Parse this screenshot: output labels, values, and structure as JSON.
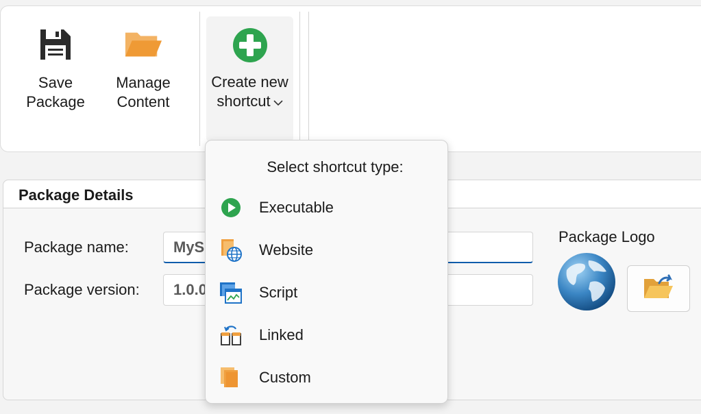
{
  "ribbon": {
    "save_label_line1": "Save",
    "save_label_line2": "Package",
    "manage_label_line1": "Manage",
    "manage_label_line2": "Content",
    "create_label_line1": "Create new",
    "create_label_line2": "shortcut",
    "create_chevron": "∨"
  },
  "details": {
    "header": "Package Details",
    "name_label": "Package name:",
    "name_value": "MyS",
    "version_label": "Package version:",
    "version_value": "1.0.0",
    "logo_label": "Package Logo"
  },
  "shortcut_menu": {
    "title": "Select shortcut type:",
    "items": [
      {
        "label": "Executable",
        "icon": "play-icon"
      },
      {
        "label": "Website",
        "icon": "website-icon"
      },
      {
        "label": "Script",
        "icon": "script-icon"
      },
      {
        "label": "Linked",
        "icon": "linked-icon"
      },
      {
        "label": "Custom",
        "icon": "custom-icon"
      }
    ]
  },
  "colors": {
    "accent_blue": "#0f5cab",
    "green": "#2ea44f",
    "orange": "#f0a040"
  }
}
